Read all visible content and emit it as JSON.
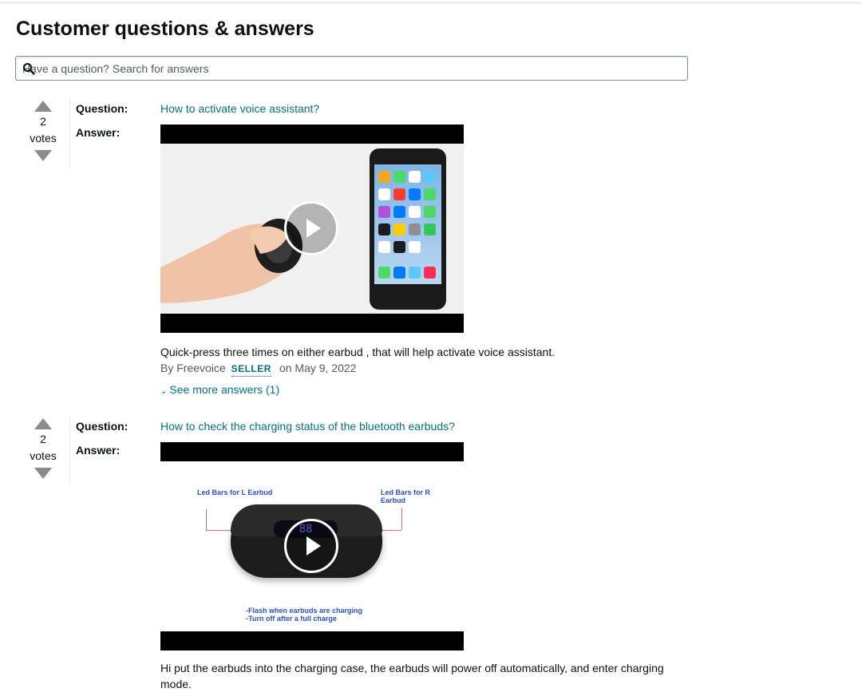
{
  "section": {
    "title": "Customer questions & answers"
  },
  "search": {
    "placeholder": "Have a question? Search for answers"
  },
  "labels": {
    "question": "Question:",
    "answer": "Answer:",
    "votes": "votes",
    "by": "By",
    "on": "on"
  },
  "icons": {
    "search": "search-icon",
    "upvote": "triangle-up-icon",
    "downvote": "triangle-down-icon",
    "play": "play-icon",
    "chevron": "chevron-down-icon"
  },
  "colors": {
    "link": "#007185",
    "text": "#0f1111",
    "muted": "#565959",
    "vote_arrow": "#888c8c"
  },
  "questions": [
    {
      "votes": "2",
      "question": "How to activate voice assistant?",
      "answer": "Quick-press three times on either earbud , that will help activate voice assistant.",
      "author": "Freevoice",
      "badge": "SELLER",
      "date": "May 9, 2022",
      "more": "See more answers (1)"
    },
    {
      "votes": "2",
      "question": "How to check the charging status of the bluetooth earbuds?",
      "answer": "Hi put the earbuds into the charging case, the earbuds will power off automatically, and enter charging mode.",
      "video_text": {
        "left_tag": "Led Bars for L Earbud",
        "right_tag": "Led Bars for R Earbud",
        "led_digits": "88",
        "caption_line1": "-Flash when earbuds are charging",
        "caption_line2": "-Turn off after a full charge"
      }
    }
  ]
}
